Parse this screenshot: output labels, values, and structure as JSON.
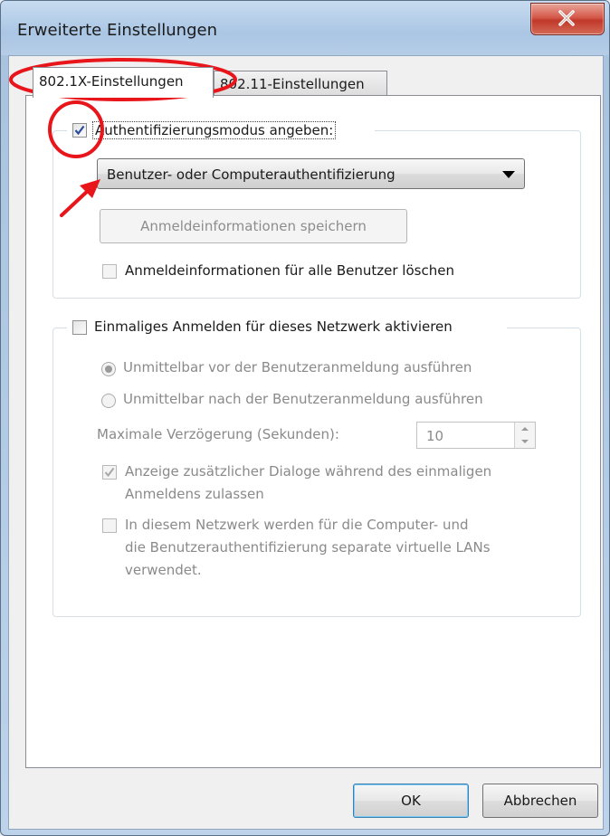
{
  "window": {
    "title": "Erweiterte Einstellungen",
    "close_icon": "close-icon"
  },
  "tabs": [
    {
      "label": "802.1X-Einstellungen",
      "active": true
    },
    {
      "label": "802.11-Einstellungen",
      "active": false
    }
  ],
  "auth_group": {
    "specify_mode_label": "Authentifizierungsmodus angeben:",
    "specify_mode_checked": true,
    "mode_value": "Benutzer- oder Computerauthentifizierung",
    "save_credentials_label": "Anmeldeinformationen speichern",
    "delete_credentials_label": "Anmeldeinformationen für alle Benutzer löschen",
    "delete_credentials_checked": false
  },
  "sso_group": {
    "enable_label": "Einmaliges Anmelden für dieses Netzwerk aktivieren",
    "enable_checked": false,
    "radio_before_label": "Unmittelbar vor der Benutzeranmeldung ausführen",
    "radio_after_label": "Unmittelbar nach der Benutzeranmeldung ausführen",
    "max_delay_label": "Maximale Verzögerung (Sekunden):",
    "max_delay_value": "10",
    "show_dialogs_label_1": "Anzeige zusätzlicher Dialoge während des einmaligen",
    "show_dialogs_label_2": "Anmeldens zulassen",
    "show_dialogs_checked": true,
    "separate_vlan_label_1": "In diesem Netzwerk werden für die Computer- und",
    "separate_vlan_label_2": "die Benutzerauthentifizierung separate virtuelle LANs",
    "separate_vlan_label_3": "verwendet.",
    "separate_vlan_checked": false
  },
  "footer": {
    "ok_label": "OK",
    "cancel_label": "Abbrechen"
  },
  "colors": {
    "annotation_red": "#e8151b",
    "close_red": "#c0382a"
  }
}
